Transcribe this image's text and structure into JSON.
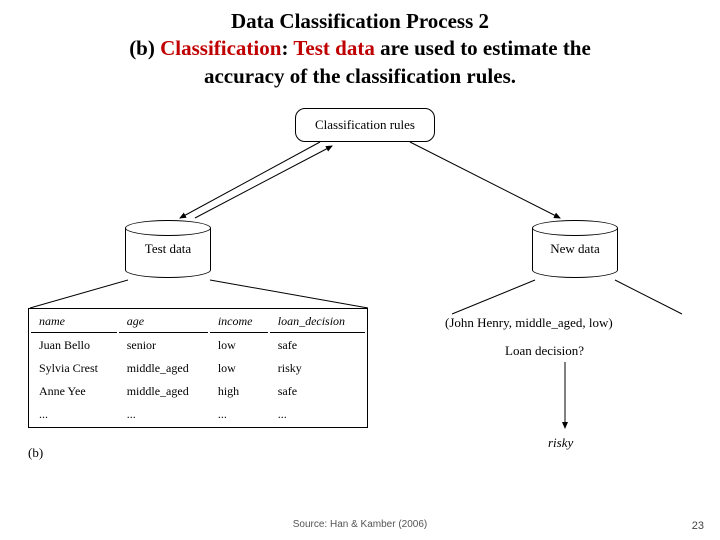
{
  "title": {
    "line1": "Data Classification Process 2",
    "line2_prefix": "(b) ",
    "line2_classification": "Classification",
    "line2_colon": ": ",
    "line2_testdata": "Test data",
    "line2_suffix": " are used to estimate the",
    "line3": "accuracy of the classification rules."
  },
  "diagram": {
    "rules_box": "Classification rules",
    "test_data_label": "Test data",
    "new_data_label": "New data",
    "tuple_text": "(John Henry, middle_aged, low)",
    "loan_question": "Loan decision?",
    "risky_result": "risky",
    "part_label": "(b)"
  },
  "table": {
    "headers": [
      "name",
      "age",
      "income",
      "loan_decision"
    ],
    "rows": [
      [
        "Juan Bello",
        "senior",
        "low",
        "safe"
      ],
      [
        "Sylvia Crest",
        "middle_aged",
        "low",
        "risky"
      ],
      [
        "Anne Yee",
        "middle_aged",
        "high",
        "safe"
      ],
      [
        "...",
        "...",
        "...",
        "..."
      ]
    ]
  },
  "footer": {
    "source": "Source: Han & Kamber (2006)",
    "page": "23"
  }
}
